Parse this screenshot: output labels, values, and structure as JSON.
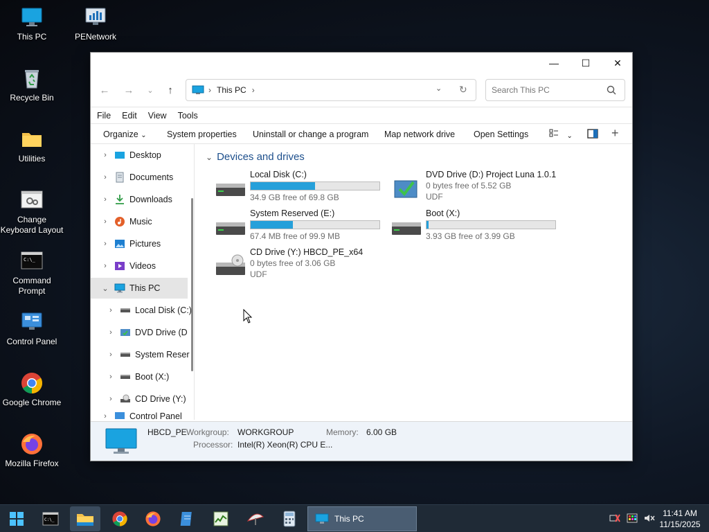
{
  "desktop": {
    "icons": [
      {
        "label": "This PC"
      },
      {
        "label": "PENetwork"
      },
      {
        "label": "Recycle Bin"
      },
      {
        "label": "Utilities"
      },
      {
        "label": "Change Keyboard Layout"
      },
      {
        "label": "Command Prompt"
      },
      {
        "label": "Control Panel"
      },
      {
        "label": "Google Chrome"
      },
      {
        "label": "Mozilla Firefox"
      }
    ]
  },
  "window": {
    "title_controls": {
      "minimize": "—",
      "maximize": "☐",
      "close": "✕"
    },
    "address": {
      "path_label": "This PC",
      "sep1": "›",
      "sep2": "›"
    },
    "search": {
      "placeholder": "Search This PC"
    },
    "menu": [
      "File",
      "Edit",
      "View",
      "Tools"
    ],
    "toolbar": {
      "organize": "Organize",
      "system_properties": "System properties",
      "uninstall": "Uninstall or change a program",
      "map_drive": "Map network drive",
      "open_settings": "Open Settings"
    },
    "nav": [
      {
        "label": "Desktop"
      },
      {
        "label": "Documents"
      },
      {
        "label": "Downloads"
      },
      {
        "label": "Music"
      },
      {
        "label": "Pictures"
      },
      {
        "label": "Videos"
      },
      {
        "label": "This PC"
      },
      {
        "label": "Local Disk (C:)"
      },
      {
        "label": "DVD Drive (D"
      },
      {
        "label": "System Reser"
      },
      {
        "label": "Boot (X:)"
      },
      {
        "label": "CD Drive (Y:)"
      },
      {
        "label": "Control Panel"
      }
    ],
    "group_title": "Devices and drives",
    "drives": [
      {
        "name": "Local Disk (C:)",
        "free": "34.9 GB free of 69.8 GB",
        "used_fraction": 0.5
      },
      {
        "name": "DVD Drive (D:) Project Luna 1.0.1",
        "free": "0 bytes free of 5.52 GB",
        "fs": "UDF"
      },
      {
        "name": "System Reserved (E:)",
        "free": "67.4 MB free of 99.9 MB",
        "used_fraction": 0.33
      },
      {
        "name": "Boot (X:)",
        "free": "3.93 GB free of 3.99 GB",
        "used_fraction": 0.015
      },
      {
        "name": "CD Drive (Y:) HBCD_PE_x64",
        "free": "0 bytes free of 3.06 GB",
        "fs": "UDF"
      }
    ],
    "details": {
      "name": "HBCD_PE",
      "workgroup_label": "Workgroup:",
      "workgroup": "WORKGROUP",
      "memory_label": "Memory:",
      "memory": "6.00 GB",
      "processor_label": "Processor:",
      "processor": "Intel(R) Xeon(R) CPU E..."
    }
  },
  "taskbar": {
    "active_window": "This PC",
    "time": "11:41 AM",
    "date": "11/15/2025"
  }
}
